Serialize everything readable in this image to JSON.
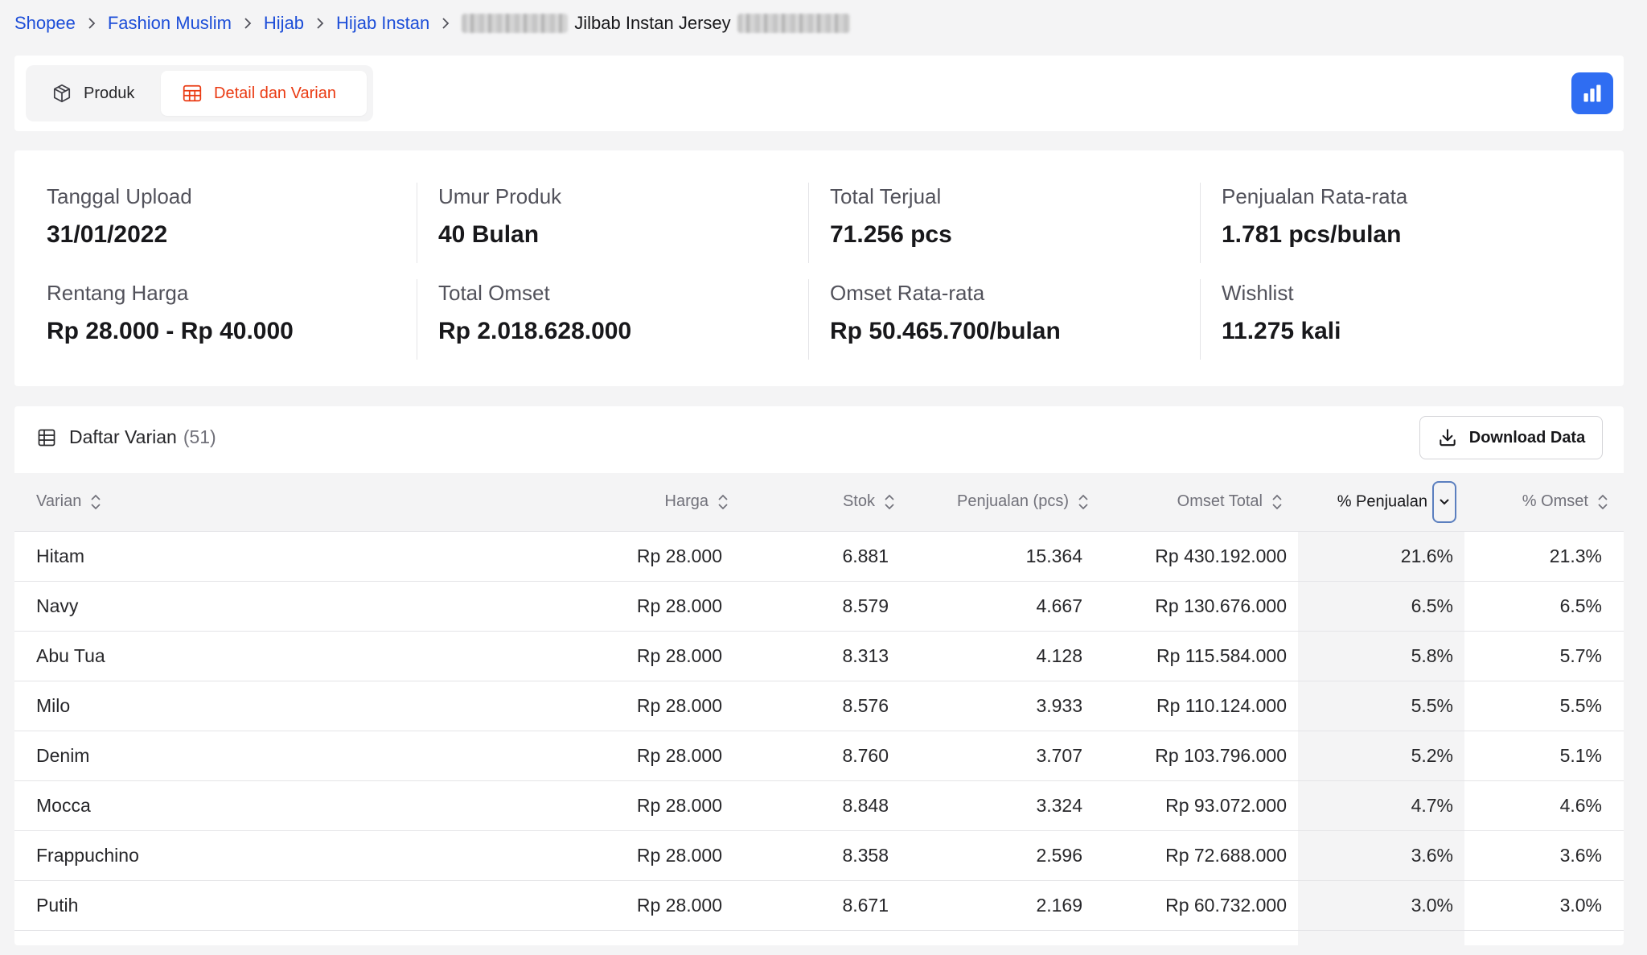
{
  "breadcrumb": {
    "items": [
      "Shopee",
      "Fashion Muslim",
      "Hijab",
      "Hijab Instan"
    ],
    "current": "Jilbab Instan Jersey"
  },
  "tabs": {
    "produk": "Produk",
    "detail": "Detail dan Varian"
  },
  "stats": {
    "tanggal_upload": {
      "label": "Tanggal Upload",
      "value": "31/01/2022"
    },
    "umur_produk": {
      "label": "Umur Produk",
      "value": "40 Bulan"
    },
    "total_terjual": {
      "label": "Total Terjual",
      "value": "71.256 pcs"
    },
    "penjualan_rata": {
      "label": "Penjualan Rata-rata",
      "value": "1.781 pcs/bulan"
    },
    "rentang_harga": {
      "label": "Rentang Harga",
      "value": "Rp 28.000 - Rp 40.000"
    },
    "total_omset": {
      "label": "Total Omset",
      "value": "Rp 2.018.628.000"
    },
    "omset_rata": {
      "label": "Omset Rata-rata",
      "value": "Rp 50.465.700/bulan"
    },
    "wishlist": {
      "label": "Wishlist",
      "value": "11.275 kali"
    }
  },
  "variants": {
    "title": "Daftar Varian",
    "count": "(51)",
    "download_label": "Download Data",
    "columns": {
      "varian": "Varian",
      "harga": "Harga",
      "stok": "Stok",
      "penjualan": "Penjualan (pcs)",
      "omset": "Omset Total",
      "pct_penjualan": "% Penjualan",
      "pct_omset": "% Omset"
    },
    "rows": [
      {
        "varian": "Hitam",
        "harga": "Rp 28.000",
        "stok": "6.881",
        "penjualan": "15.364",
        "omset": "Rp 430.192.000",
        "pct_penjualan": "21.6%",
        "pct_omset": "21.3%"
      },
      {
        "varian": "Navy",
        "harga": "Rp 28.000",
        "stok": "8.579",
        "penjualan": "4.667",
        "omset": "Rp 130.676.000",
        "pct_penjualan": "6.5%",
        "pct_omset": "6.5%"
      },
      {
        "varian": "Abu Tua",
        "harga": "Rp 28.000",
        "stok": "8.313",
        "penjualan": "4.128",
        "omset": "Rp 115.584.000",
        "pct_penjualan": "5.8%",
        "pct_omset": "5.7%"
      },
      {
        "varian": "Milo",
        "harga": "Rp 28.000",
        "stok": "8.576",
        "penjualan": "3.933",
        "omset": "Rp 110.124.000",
        "pct_penjualan": "5.5%",
        "pct_omset": "5.5%"
      },
      {
        "varian": "Denim",
        "harga": "Rp 28.000",
        "stok": "8.760",
        "penjualan": "3.707",
        "omset": "Rp 103.796.000",
        "pct_penjualan": "5.2%",
        "pct_omset": "5.1%"
      },
      {
        "varian": "Mocca",
        "harga": "Rp 28.000",
        "stok": "8.848",
        "penjualan": "3.324",
        "omset": "Rp 93.072.000",
        "pct_penjualan": "4.7%",
        "pct_omset": "4.6%"
      },
      {
        "varian": "Frappuchino",
        "harga": "Rp 28.000",
        "stok": "8.358",
        "penjualan": "2.596",
        "omset": "Rp 72.688.000",
        "pct_penjualan": "3.6%",
        "pct_omset": "3.6%"
      },
      {
        "varian": "Putih",
        "harga": "Rp 28.000",
        "stok": "8.671",
        "penjualan": "2.169",
        "omset": "Rp 60.732.000",
        "pct_penjualan": "3.0%",
        "pct_omset": "3.0%"
      }
    ]
  },
  "icons": {
    "breadcrumb_separator": "chevron-right-icon",
    "produk_tab": "cube-icon",
    "detail_tab": "table-icon",
    "chart_button": "bar-chart-icon",
    "variants_title": "grid-icon",
    "download": "download-icon",
    "sort": "sort-icon",
    "sort_active": "chevron-down-icon"
  },
  "colors": {
    "link": "#1d4ed8",
    "active_tab": "#ea3a12",
    "chart_button": "#2f6df2",
    "active_sort_border": "#5b7fbf"
  }
}
